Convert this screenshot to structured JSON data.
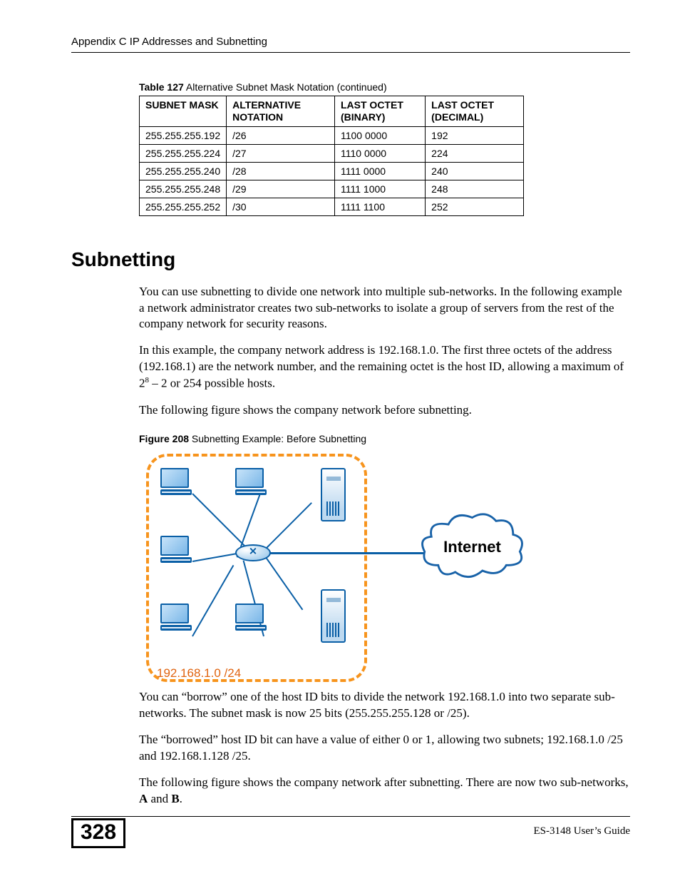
{
  "header": "Appendix C IP Addresses and Subnetting",
  "table": {
    "caption_bold": "Table 127",
    "caption_rest": "   Alternative Subnet Mask Notation (continued)",
    "headers": [
      "SUBNET MASK",
      "ALTERNATIVE NOTATION",
      "LAST OCTET (BINARY)",
      "LAST OCTET (DECIMAL)"
    ],
    "rows": [
      [
        "255.255.255.192",
        "/26",
        "1100 0000",
        "192"
      ],
      [
        "255.255.255.224",
        "/27",
        "1110 0000",
        "224"
      ],
      [
        "255.255.255.240",
        "/28",
        "1111 0000",
        "240"
      ],
      [
        "255.255.255.248",
        "/29",
        "1111 1000",
        "248"
      ],
      [
        "255.255.255.252",
        "/30",
        "1111 1100",
        "252"
      ]
    ]
  },
  "section_heading": "Subnetting",
  "para1": "You can use subnetting to divide one network into multiple sub-networks. In the following example a network administrator creates two sub-networks to isolate a group of servers from the rest of the company network for security reasons.",
  "para2_a": "In this example, the company network address is 192.168.1.0. The first three octets of the address (192.168.1) are the network number, and the remaining octet is the host ID, allowing a maximum of 2",
  "para2_sup": "8",
  "para2_b": " – 2 or 254 possible hosts.",
  "para3": "The following figure shows the company network before subnetting.",
  "figure": {
    "caption_bold": "Figure 208",
    "caption_rest": "   Subnetting Example: Before Subnetting",
    "cloud_label": "Internet",
    "subnet_label": "192.168.1.0 /24"
  },
  "para4": "You can “borrow” one of the host ID bits to divide the network 192.168.1.0 into two separate sub-networks. The subnet mask is now 25 bits (255.255.255.128 or /25).",
  "para5": "The “borrowed” host ID bit can have a value of either 0 or 1, allowing two subnets; 192.168.1.0 /25 and 192.168.1.128 /25.",
  "para6_a": "The following figure shows the company network after subnetting. There are now two sub-networks, ",
  "para6_b": "A",
  "para6_c": " and ",
  "para6_d": "B",
  "para6_e": ".",
  "footer": {
    "page": "328",
    "right": "ES-3148 User’s Guide"
  }
}
